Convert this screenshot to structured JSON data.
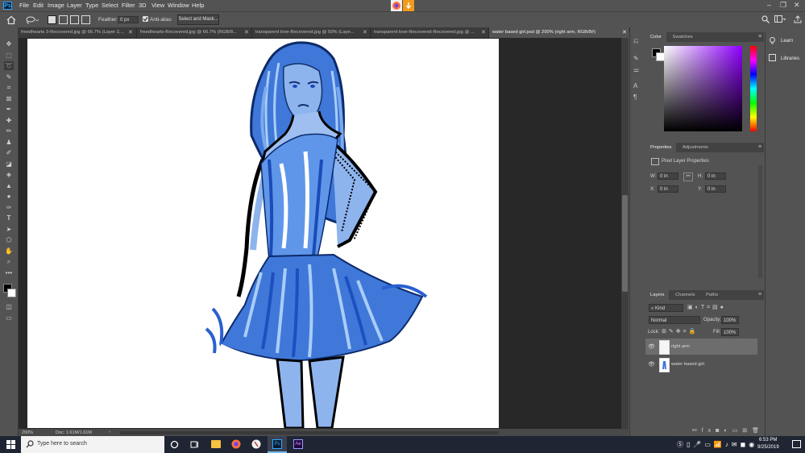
{
  "app": {
    "logo": "Ps"
  },
  "menu": [
    "File",
    "Edit",
    "Image",
    "Layer",
    "Type",
    "Select",
    "Filter",
    "3D",
    "View",
    "Window",
    "Help"
  ],
  "window_controls": [
    "–",
    "❐",
    "✕"
  ],
  "options_bar": {
    "feather_label": "Feather:",
    "feather_value": "0 px",
    "anti_alias_label": "Anti-alias",
    "select_mask_label": "Select and Mask..."
  },
  "tabs": [
    {
      "label": "freedhearts 3-Recovered.jpg @ 66.7% (Layer 2,...",
      "active": false
    },
    {
      "label": "freedhearts-Recovered.jpg @ 66.7% (RGB/8...",
      "active": false
    },
    {
      "label": "transparent love-Recovered.jpg @ 50% (Laye...",
      "active": false
    },
    {
      "label": "transparent love-Recovered-Recovered.jpg @ ...",
      "active": false
    },
    {
      "label": "water based girl.psd @ 200% (right arm, RGB/8#)",
      "active": true
    }
  ],
  "status": {
    "zoom": "200%",
    "doc": "Doc: 1.61M/1.61M"
  },
  "color_panel": {
    "tabs": [
      "Color",
      "Swatches"
    ]
  },
  "properties_panel": {
    "tabs": [
      "Properties",
      "Adjustments"
    ],
    "section_title": "Pixel Layer Properties",
    "w_label": "W:",
    "w_value": "0 in",
    "h_label": "H:",
    "h_value": "0 in",
    "x_label": "X:",
    "x_value": "0 in",
    "y_label": "Y:",
    "y_value": "0 in"
  },
  "layers_panel": {
    "tabs": [
      "Layers",
      "Channels",
      "Paths"
    ],
    "kind_label": "Kind",
    "blend_mode": "Normal",
    "opacity_label": "Opacity:",
    "opacity_value": "100%",
    "lock_label": "Lock:",
    "fill_label": "Fill:",
    "fill_value": "100%",
    "layers": [
      {
        "name": "right arm",
        "selected": true
      },
      {
        "name": "water based girl",
        "selected": false
      }
    ]
  },
  "learn_panel": {
    "learn": "Learn",
    "libraries": "Libraries"
  },
  "taskbar": {
    "search_placeholder": "Type here to search",
    "time": "6:53 PM",
    "date": "9/25/2019"
  },
  "colors": {
    "accent": "#31a8ff",
    "ui_bg": "#535353",
    "dark_bg": "#282828"
  }
}
